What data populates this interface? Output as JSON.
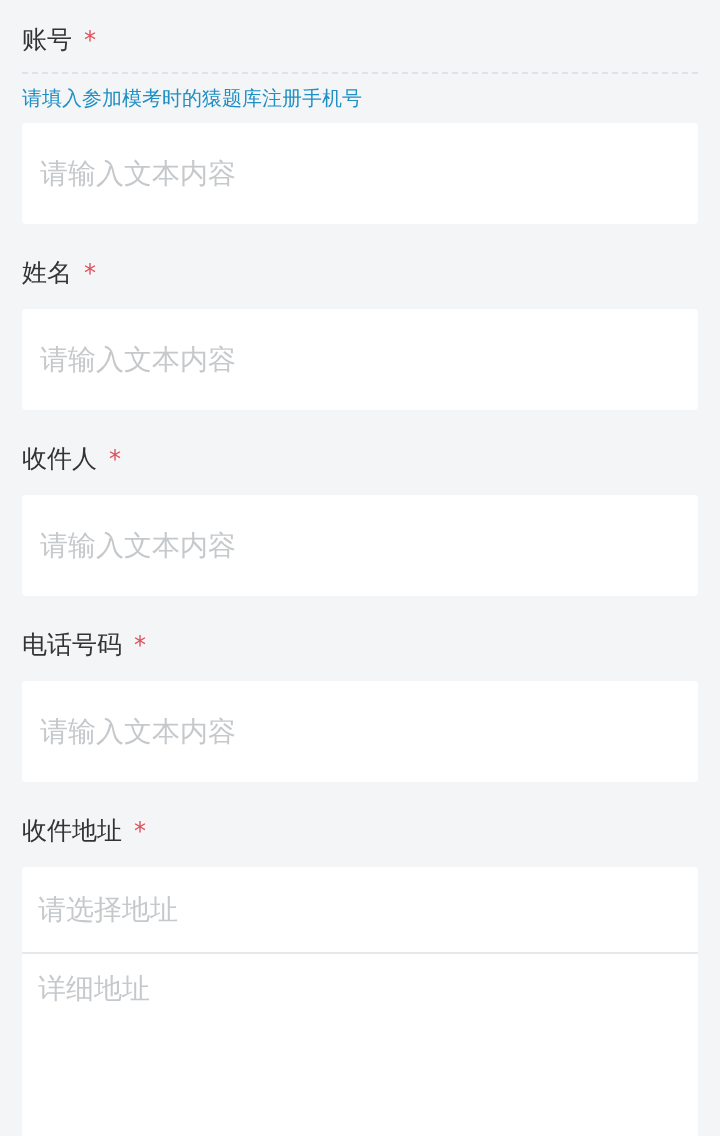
{
  "fields": [
    {
      "kind": "text",
      "label": "账号",
      "required_mark": "*",
      "hint": "请填入参加模考时的猿题库注册手机号",
      "placeholder": "请输入文本内容"
    },
    {
      "kind": "text",
      "label": "姓名",
      "required_mark": "*",
      "placeholder": "请输入文本内容"
    },
    {
      "kind": "text",
      "label": "收件人",
      "required_mark": "*",
      "placeholder": "请输入文本内容"
    },
    {
      "kind": "text",
      "label": "电话号码",
      "required_mark": "*",
      "placeholder": "请输入文本内容"
    },
    {
      "kind": "address",
      "label": "收件地址",
      "required_mark": "*",
      "select_placeholder": "请选择地址",
      "detail_placeholder": "详细地址"
    }
  ]
}
